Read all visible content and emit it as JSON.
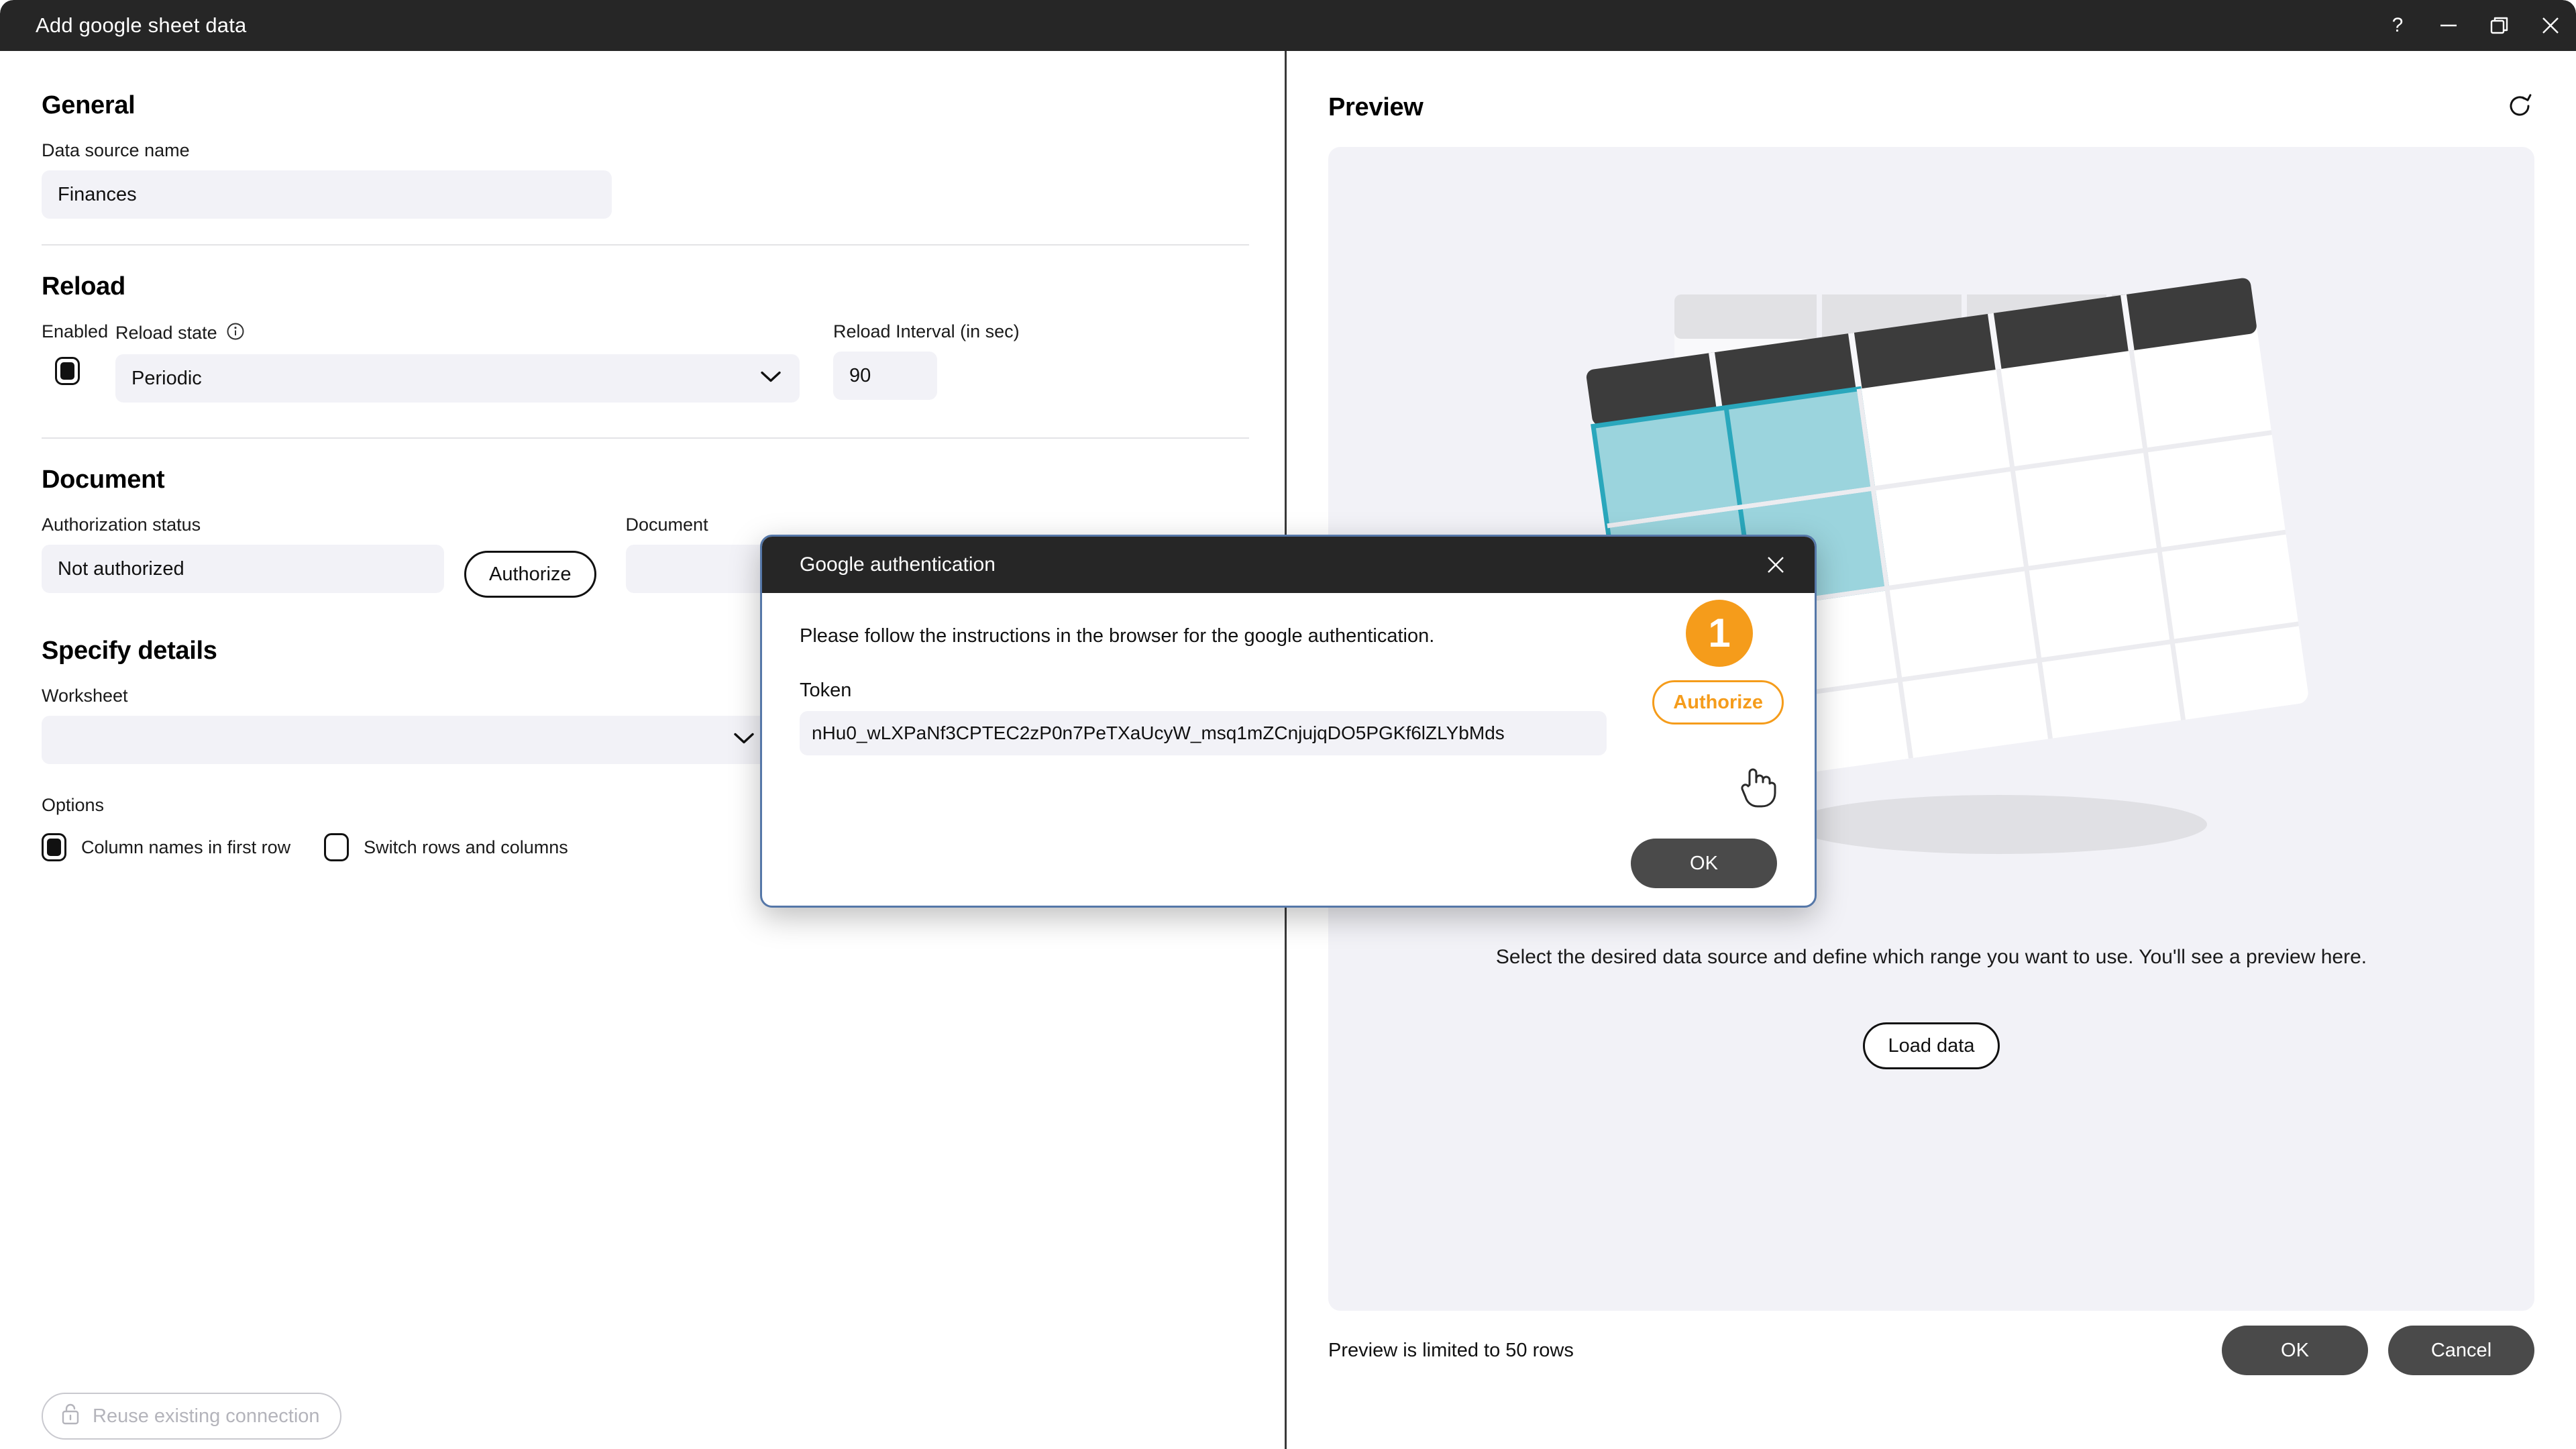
{
  "window": {
    "title": "Add google sheet data",
    "controls": [
      {
        "name": "help",
        "glyph": "?"
      },
      {
        "name": "minimize",
        "glyph": "—"
      },
      {
        "name": "restore",
        "glyph": "❐"
      },
      {
        "name": "close",
        "glyph": "✕"
      }
    ]
  },
  "general": {
    "heading": "General",
    "data_source_name_label": "Data source name",
    "data_source_name_value": "Finances"
  },
  "reload": {
    "heading": "Reload",
    "enabled_label": "Enabled",
    "enabled_checked": true,
    "reload_state_label": "Reload state",
    "reload_state_value": "Periodic",
    "interval_label": "Reload Interval (in sec)",
    "interval_value": "90"
  },
  "document": {
    "heading": "Document",
    "auth_status_label": "Authorization status",
    "auth_status_value": "Not authorized",
    "authorize_button": "Authorize",
    "document_label": "Document",
    "document_value": ""
  },
  "specify_details": {
    "heading": "Specify details",
    "worksheet_label": "Worksheet",
    "worksheet_value": "",
    "options_label": "Options",
    "options": [
      {
        "label": "Column names in first row",
        "checked": true
      },
      {
        "label": "Switch rows and columns",
        "checked": false
      }
    ]
  },
  "footer_left": {
    "reuse_connection_label": "Reuse existing connection",
    "reuse_connection_disabled": true
  },
  "preview": {
    "heading": "Preview",
    "refresh_icon": "refresh-icon",
    "empty_message": "Select the desired data source and define which range you want to use. You'll see a preview here.",
    "load_data_button": "Load data",
    "limit_note": "Preview is limited to 50 rows",
    "ok_button": "OK",
    "cancel_button": "Cancel"
  },
  "modal": {
    "title": "Google authentication",
    "instruction": "Please follow the instructions in the browser for the google authentication.",
    "token_label": "Token",
    "token_value": "nHu0_wLXPaNf3CPTEC2zP0n7PeTXaUcyW_msq1mZCnjujqDO5PGKf6lZLYbMds",
    "badge_number": "1",
    "authorize_button": "Authorize",
    "ok_button": "OK",
    "close_icon": "close-icon"
  },
  "colors": {
    "titlebar": "#262626",
    "accent_orange": "#F59C1B",
    "input_bg": "#f2f2f7",
    "dark_button": "#4a4a4a",
    "modal_border": "#5577a8",
    "illustration_teal": "#7FCBD4"
  }
}
